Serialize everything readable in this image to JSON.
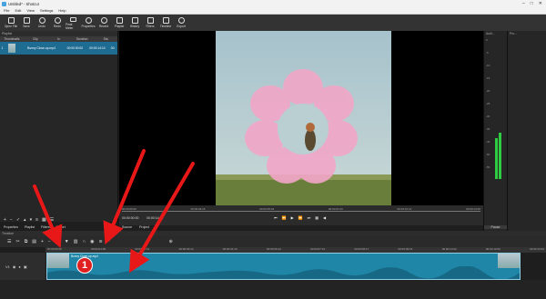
{
  "window": {
    "title": "Untitled* - Shotcut",
    "controls": [
      "–",
      "□",
      "✕"
    ]
  },
  "menu": [
    "File",
    "Edit",
    "View",
    "Settings",
    "Help"
  ],
  "toolbar": [
    {
      "label": "Open File",
      "icon": "open-file-icon"
    },
    {
      "label": "Save",
      "icon": "save-icon"
    },
    {
      "label": "Undo",
      "icon": "undo-icon"
    },
    {
      "label": "Redo",
      "icon": "redo-icon"
    },
    {
      "label": "Peak Meter",
      "icon": "peak-meter-icon"
    },
    {
      "label": "Properties",
      "icon": "properties-icon"
    },
    {
      "label": "Recent",
      "icon": "recent-icon"
    },
    {
      "label": "Playlist",
      "icon": "playlist-icon"
    },
    {
      "label": "History",
      "icon": "history-icon"
    },
    {
      "label": "Filters",
      "icon": "filters-icon"
    },
    {
      "label": "Timeline",
      "icon": "timeline-icon"
    },
    {
      "label": "Export",
      "icon": "export-icon"
    }
  ],
  "playlist": {
    "panel_title": "Playlist",
    "columns": [
      "Thumbnails",
      "Clip",
      "In",
      "Duration",
      "Sta"
    ],
    "rows": [
      {
        "num": "1",
        "clip": "Bunny Close-up.mp4",
        "in": "00:00:00:00",
        "duration": "00:00:14:14",
        "start": "00:"
      }
    ],
    "tabs": [
      "Properties",
      "Playlist",
      "Filters",
      "Export"
    ]
  },
  "viewer": {
    "timecode_current": "00:00:00:00",
    "timecode_total": "00:00:14:14",
    "tabs": [
      "Source",
      "Project"
    ],
    "ticks": [
      "00:00:00:00",
      "00:00:02:15",
      "00:00:05:04",
      "00:00:07:23",
      "00:00:10:12",
      "00:00:13:00"
    ]
  },
  "audio": {
    "title": "Audi...",
    "scale": [
      "0",
      "-5",
      "-10",
      "-15",
      "-20",
      "-25",
      "-30",
      "-35",
      "-40",
      "-50",
      "-55"
    ],
    "pause_label": "Pause",
    "levels": [
      0.3,
      0.35
    ]
  },
  "properties": {
    "title": "Pro..."
  },
  "timeline": {
    "title": "Timeline",
    "track_name": "V1",
    "clip_label": "Bunny Close-up.mp4",
    "ruler": [
      "00:00:00:00",
      "00:00:01:00",
      "00:00:02:10",
      "00:00:03:10",
      "00:00:04:13",
      "00:00:06:12",
      "00:00:07:13",
      "00:00:08:17",
      "00:00:09:15",
      "00:00:10:22",
      "00:00:12:00",
      "00:00:13:04"
    ]
  },
  "annotation": {
    "badge_number": "1",
    "arrow_color": "#e81818"
  },
  "colors": {
    "accent": "#1f86a8",
    "selection": "#1f6c93",
    "meter": "#2ecc40"
  }
}
